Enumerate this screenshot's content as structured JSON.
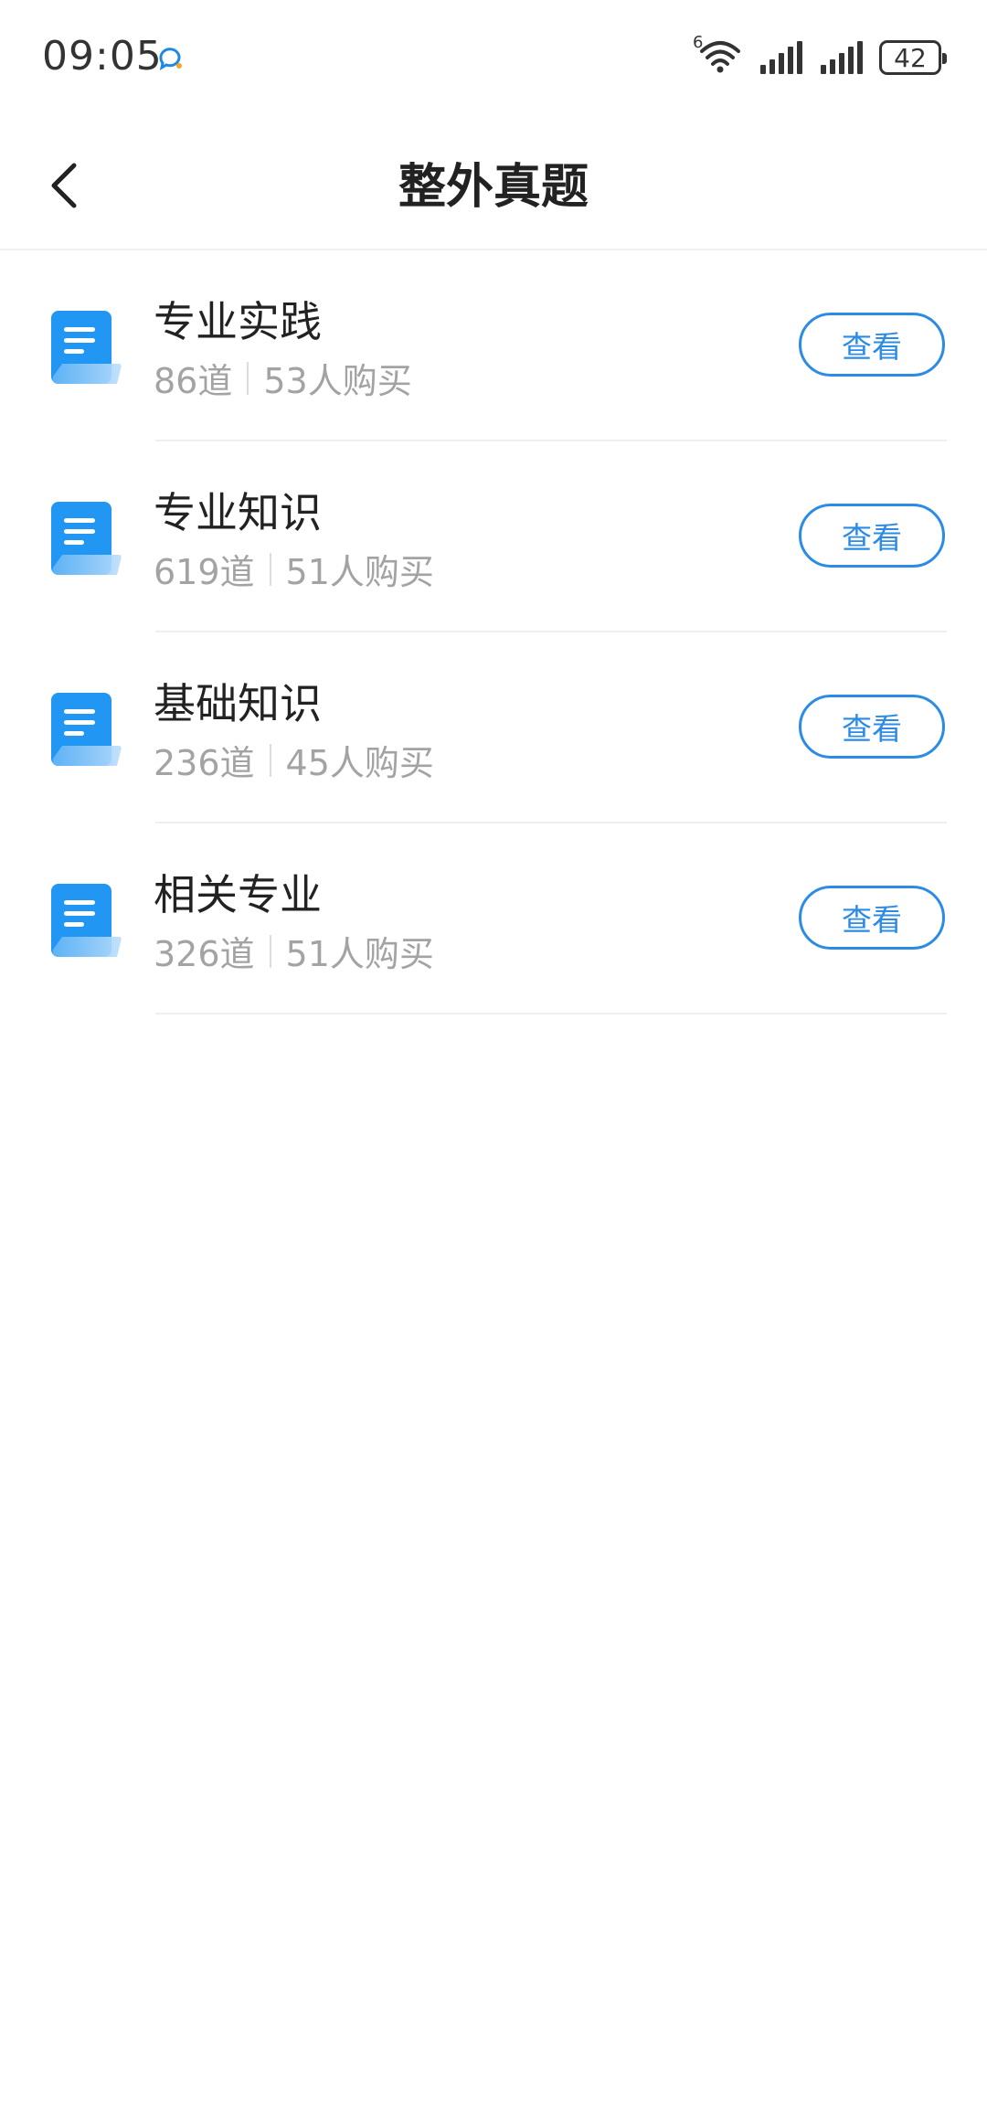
{
  "status_bar": {
    "time": "09:05",
    "battery": "42",
    "network_label": "6"
  },
  "header": {
    "title": "整外真题"
  },
  "items": [
    {
      "title": "专业实践",
      "count": "86道",
      "buyers": "53人购买",
      "button": "查看"
    },
    {
      "title": "专业知识",
      "count": "619道",
      "buyers": "51人购买",
      "button": "查看"
    },
    {
      "title": "基础知识",
      "count": "236道",
      "buyers": "45人购买",
      "button": "查看"
    },
    {
      "title": "相关专业",
      "count": "326道",
      "buyers": "51人购买",
      "button": "查看"
    }
  ],
  "colors": {
    "accent": "#2b8be5",
    "icon_blue": "#2196f3"
  },
  "icons": {
    "back": "chevron-left-icon",
    "document": "document-icon",
    "wifi": "wifi-icon",
    "signal": "signal-icon",
    "battery": "battery-icon",
    "chat": "chat-bubble-icon"
  }
}
